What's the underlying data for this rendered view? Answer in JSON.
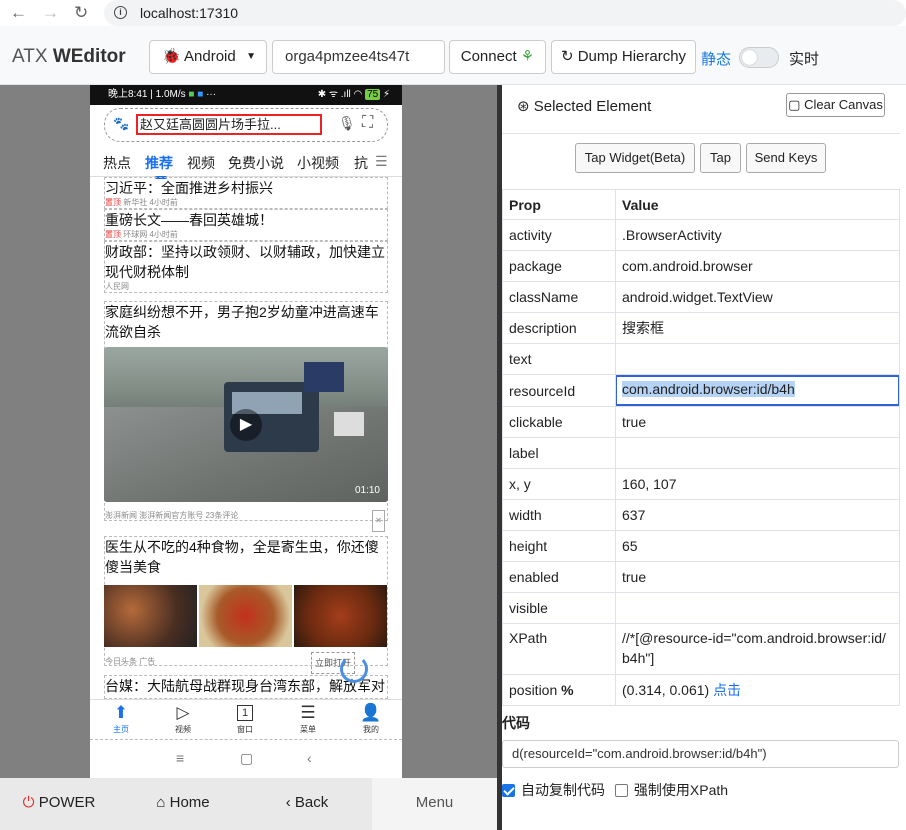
{
  "browser": {
    "url": "localhost:17310"
  },
  "app": {
    "brand_prefix": "ATX",
    "brand_name": "WEditor"
  },
  "toolbar": {
    "platform": "Android",
    "serial": "orga4pmzee4ts47t",
    "connect": "Connect",
    "dump": "Dump Hierarchy",
    "static": "静态",
    "realtime": "实时"
  },
  "phone": {
    "status_left": "晚上8:41 | 1.0M/s",
    "status_right": "75",
    "search_text": "赵又廷高圆圆片场手拉...",
    "tabs": [
      "热点",
      "推荐",
      "视频",
      "免费小说",
      "小视频",
      "抗"
    ],
    "active_tab": "推荐",
    "news": [
      {
        "title": "习近平：全面推进乡村振兴",
        "meta_tag": "置顶",
        "meta": "新华社 4小时前"
      },
      {
        "title": "重磅长文——春回英雄城！",
        "meta_tag": "置顶",
        "meta": "环球网 4小时前"
      },
      {
        "title": "财政部：坚持以政领财、以财辅政，加快建立现代财税体制",
        "meta": "人民网"
      },
      {
        "title": "家庭纠纷想不开，男子抱2岁幼童冲进高速车流欲自杀",
        "meta": "澎湃新闻 澎湃新闻官方账号 23条评论",
        "duration": "01:10"
      },
      {
        "title": "医生从不吃的4种食物，全是寄生虫，你还傻傻当美食",
        "meta": "今日头条 广告",
        "action": "立即打开"
      },
      {
        "title": "台媒：大陆航母战群现身台湾东部，解放军对"
      }
    ],
    "bottom_nav": [
      "主页",
      "视频",
      "窗口",
      "菜单",
      "我的"
    ],
    "window_count": "1"
  },
  "controls": {
    "power": "POWER",
    "home": "Home",
    "back": "Back",
    "menu": "Menu"
  },
  "inspector": {
    "title": "Selected Element",
    "clear": "Clear Canvas",
    "tap_widget": "Tap Widget(Beta)",
    "tap": "Tap",
    "send_keys": "Send Keys",
    "col_prop": "Prop",
    "col_value": "Value",
    "props": {
      "activity": ".BrowserActivity",
      "package": "com.android.browser",
      "className": "android.widget.TextView",
      "description": "搜索框",
      "text": "",
      "resourceId": "com.android.browser:id/b4h",
      "clickable": "true",
      "label": "",
      "xy": "160, 107",
      "width": "637",
      "height": "65",
      "enabled": "true",
      "visible": "",
      "xpath": "//*[@resource-id=\"com.android.browser:id/b4h\"]",
      "position": "(0.314, 0.061)",
      "position_link": "点击"
    },
    "code_label": "代码",
    "code": "d(resourceId=\"com.android.browser:id/b4h\")",
    "auto_copy": "自动复制代码",
    "force_xpath": "强制使用XPath"
  }
}
